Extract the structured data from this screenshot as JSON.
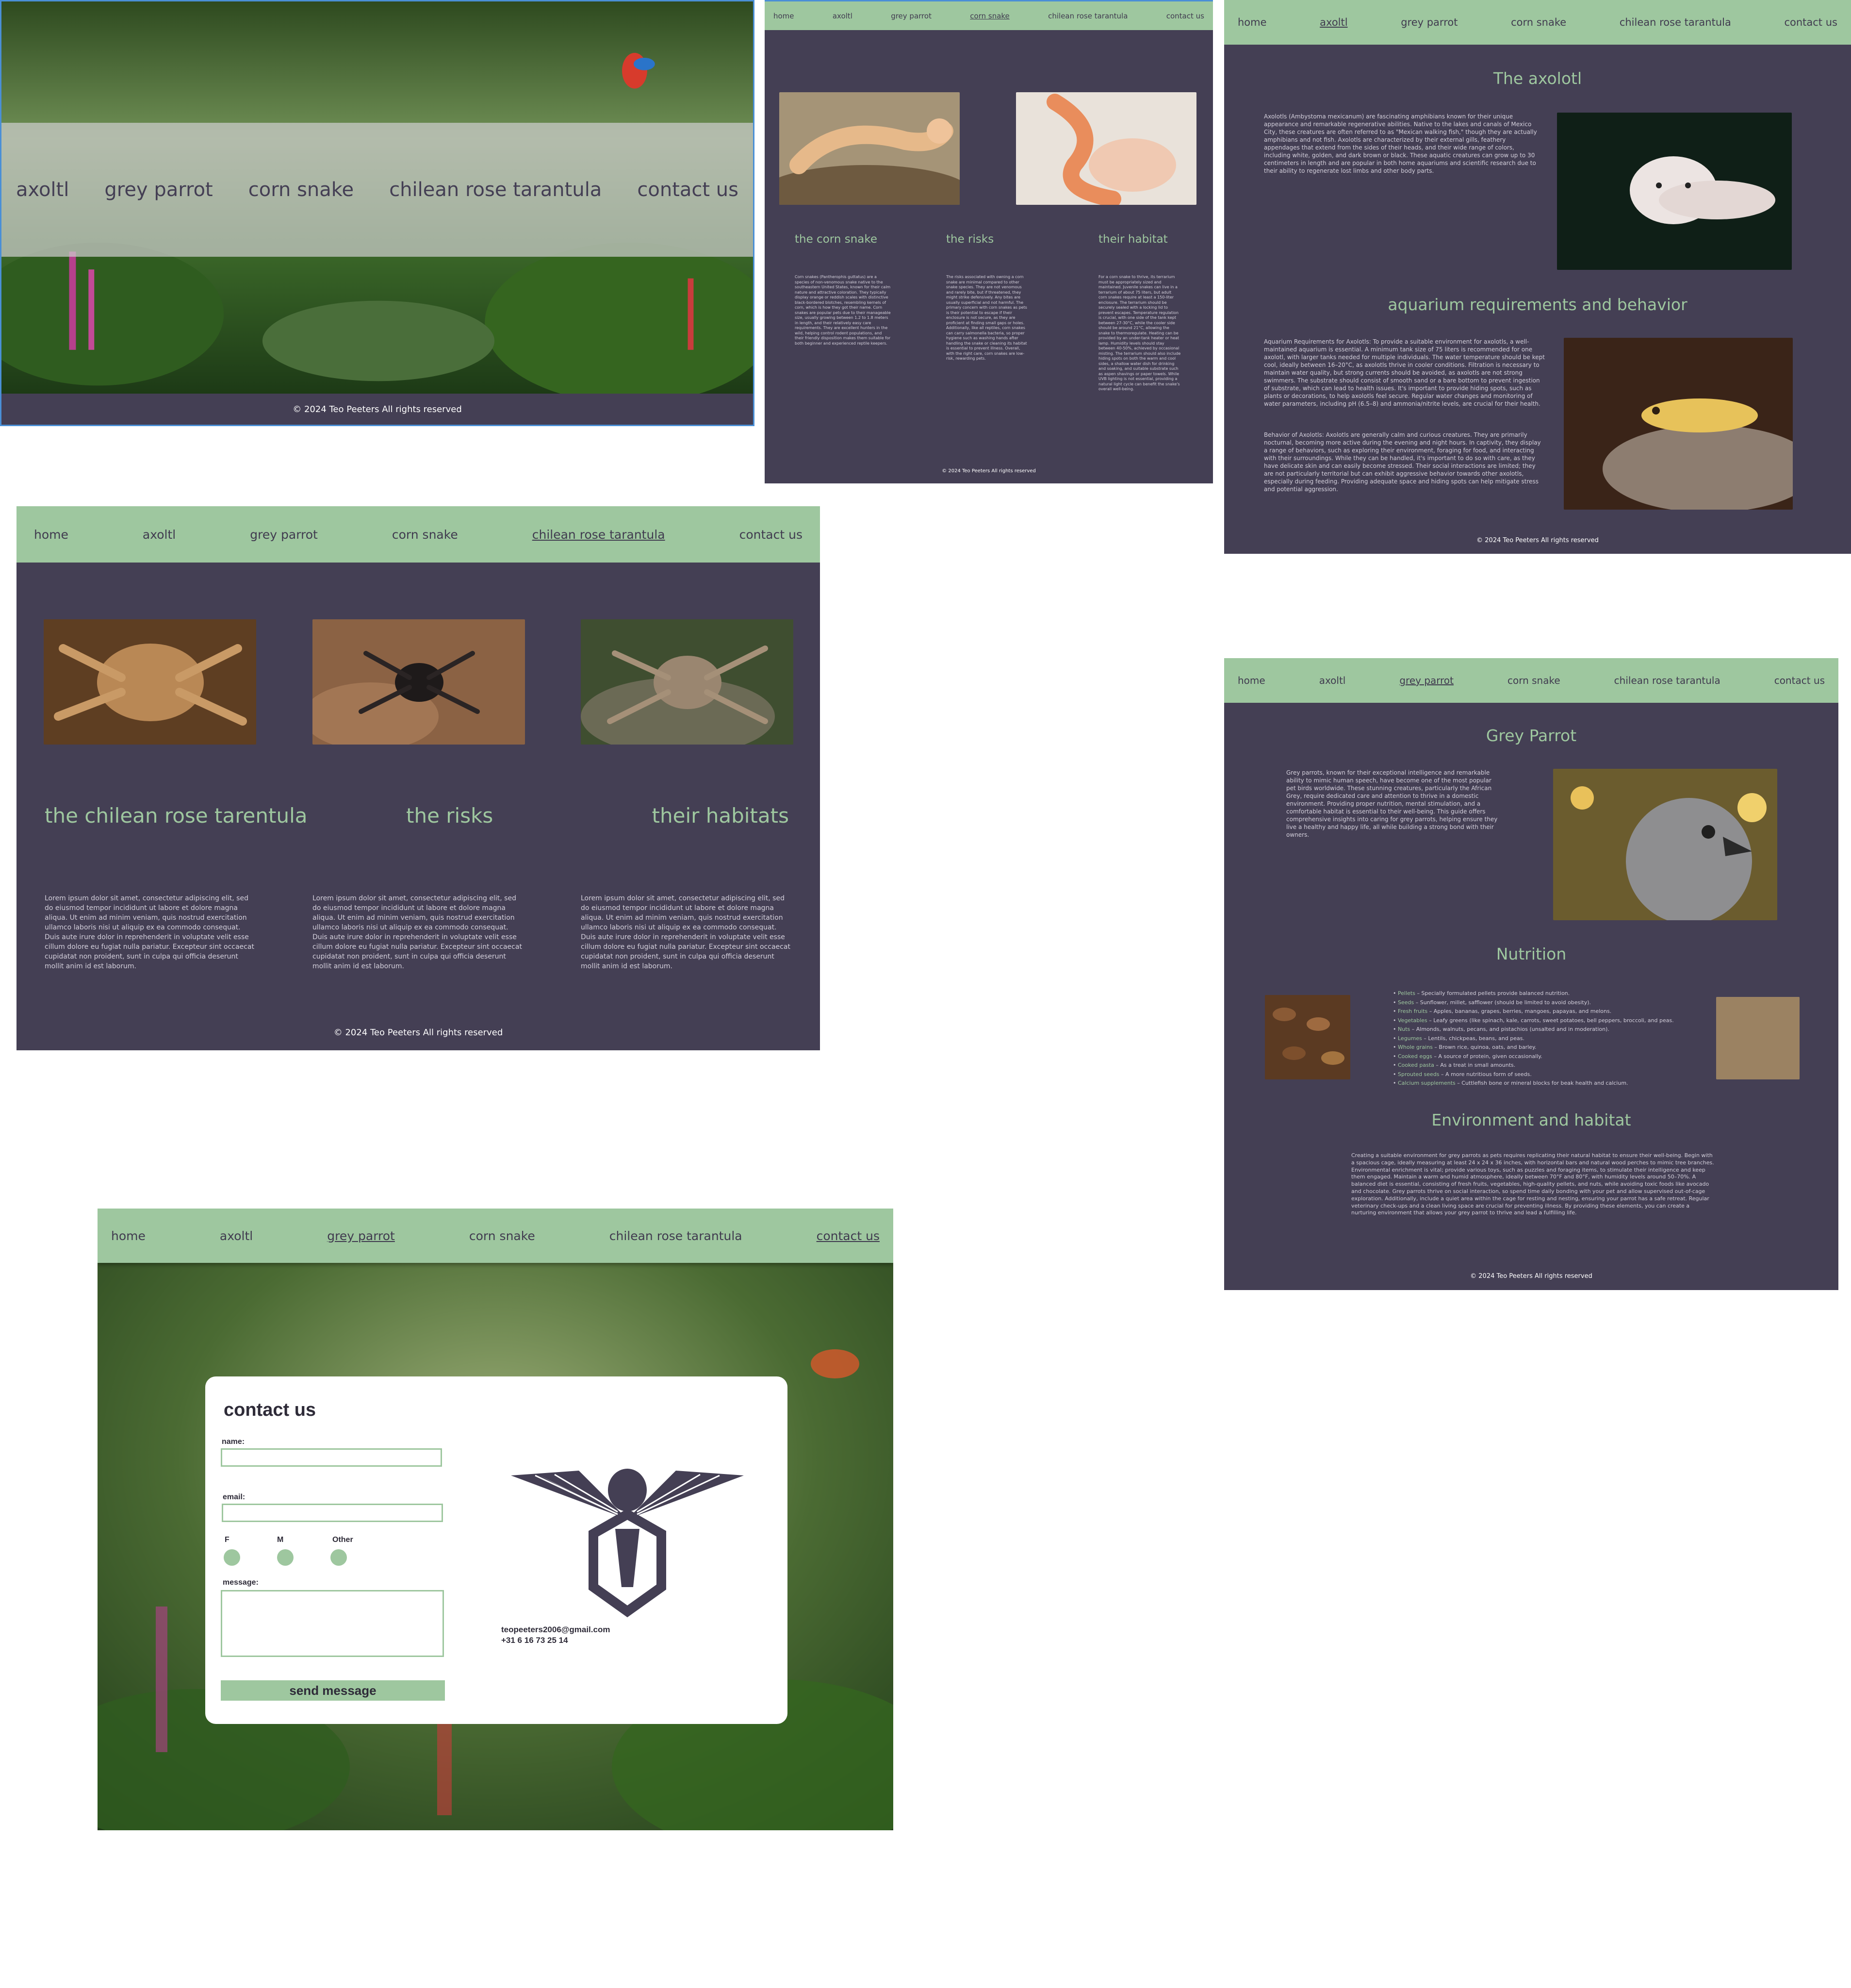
{
  "nav": {
    "home": "home",
    "axolotl": "axoltl",
    "parrot": "grey parrot",
    "snake": "corn snake",
    "tarantula": "chilean rose tarantula",
    "contact": "contact us"
  },
  "footer": "© 2024 Teo Peeters All rights reserved",
  "home_page": {
    "menu": [
      "axoltl",
      "grey parrot",
      "corn snake",
      "chilean rose tarantula",
      "contact us"
    ]
  },
  "snake_page": {
    "columns": [
      {
        "heading": "the corn snake",
        "body": "Corn snakes (Pantherophis guttatus) are a species of non-venomous snake native to the southeastern United States, known for their calm nature and attractive coloration. They typically display orange or reddish scales with distinctive black-bordered blotches, resembling kernels of corn, which is how they got their name. Corn snakes are popular pets due to their manageable size, usually growing between 1.2 to 1.8 meters in length, and their relatively easy care requirements. They are excellent hunters in the wild, helping control rodent populations, and their friendly disposition makes them suitable for both beginner and experienced reptile keepers."
      },
      {
        "heading": "the risks",
        "body": "The risks associated with owning a corn snake are minimal compared to other snake species. They are not venomous and rarely bite, but if threatened, they might strike defensively. Any bites are usually superficial and not harmful. The primary concern with corn snakes as pets is their potential to escape if their enclosure is not secure, as they are proficient at finding small gaps or holes. Additionally, like all reptiles, corn snakes can carry salmonella bacteria, so proper hygiene such as washing hands after handling the snake or cleaning its habitat is essential to prevent illness. Overall, with the right care, corn snakes are low-risk, rewarding pets."
      },
      {
        "heading": "their habitat",
        "body": "For a corn snake to thrive, its terrarium must be appropriately sized and maintained. Juvenile snakes can live in a terrarium of about 75 liters, but adult corn snakes require at least a 150-liter enclosure. The terrarium should be securely sealed with a locking lid to prevent escapes. Temperature regulation is crucial, with one side of the tank kept between 27-30°C, while the cooler side should be around 21°C, allowing the snake to thermoregulate. Heating can be provided by an under-tank heater or heat lamp. Humidity levels should stay between 40-50%, achieved by occasional misting. The terrarium should also include hiding spots on both the warm and cool sides, a shallow water dish for drinking and soaking, and suitable substrate such as aspen shavings or paper towels. While UVB lighting is not essential, providing a natural light cycle can benefit the snake's overall well-being."
      }
    ]
  },
  "axolotl_page": {
    "title": "The axolotl",
    "intro": "Axolotls (Ambystoma mexicanum) are fascinating amphibians known for their unique appearance and remarkable regenerative abilities. Native to the lakes and canals of Mexico City, these creatures are often referred to as \"Mexican walking fish,\" though they are actually amphibians and not fish. Axolotls are characterized by their external gills, feathery appendages that extend from the sides of their heads, and their wide range of colors, including white, golden, and dark brown or black. These aquatic creatures can grow up to 30 centimeters in length and are popular in both home aquariums and scientific research due to their ability to regenerate lost limbs and other body parts.",
    "subtitle": "aquarium requirements and behavior",
    "req": "Aquarium Requirements for Axolotls: To provide a suitable environment for axolotls, a well-maintained aquarium is essential. A minimum tank size of 75 liters is recommended for one axolotl, with larger tanks needed for multiple individuals. The water temperature should be kept cool, ideally between 16–20°C, as axolotls thrive in cooler conditions. Filtration is necessary to maintain water quality, but strong currents should be avoided, as axolotls are not strong swimmers. The substrate should consist of smooth sand or a bare bottom to prevent ingestion of substrate, which can lead to health issues. It's important to provide hiding spots, such as plants or decorations, to help axolotls feel secure. Regular water changes and monitoring of water parameters, including pH (6.5–8) and ammonia/nitrite levels, are crucial for their health.",
    "behavior": "Behavior of Axolotls: Axolotls are generally calm and curious creatures. They are primarily nocturnal, becoming more active during the evening and night hours. In captivity, they display a range of behaviors, such as exploring their environment, foraging for food, and interacting with their surroundings. While they can be handled, it's important to do so with care, as they have delicate skin and can easily become stressed. Their social interactions are limited; they are not particularly territorial but can exhibit aggressive behavior towards other axolotls, especially during feeding. Providing adequate space and hiding spots can help mitigate stress and potential aggression."
  },
  "tarantula_page": {
    "columns": [
      {
        "heading": "the chilean rose tarentula"
      },
      {
        "heading": "the risks"
      },
      {
        "heading": "their habitats"
      }
    ],
    "lorem": "Lorem ipsum dolor sit amet, consectetur adipiscing elit, sed do eiusmod tempor incididunt ut labore et dolore magna aliqua. Ut enim ad minim veniam, quis nostrud exercitation ullamco laboris nisi ut aliquip ex ea commodo consequat. Duis aute irure dolor in reprehenderit in voluptate velit esse cillum dolore eu fugiat nulla pariatur. Excepteur sint occaecat cupidatat non proident, sunt in culpa qui officia deserunt mollit anim id est laborum."
  },
  "parrot_page": {
    "title": "Grey Parrot",
    "intro": "Grey parrots, known for their exceptional intelligence and remarkable ability to mimic human speech, have become one of the most popular pet birds worldwide. These stunning creatures, particularly the African Grey, require dedicated care and attention to thrive in a domestic environment. Providing proper nutrition, mental stimulation, and a comfortable habitat is essential to their well-being. This guide offers comprehensive insights into caring for grey parrots, helping ensure they live a healthy and happy life, all while building a strong bond with their owners.",
    "nutrition_title": "Nutrition",
    "nutrition": [
      {
        "name": "Pellets",
        "text": "– Specially formulated pellets provide balanced nutrition."
      },
      {
        "name": "Seeds",
        "text": "– Sunflower, millet, safflower (should be limited to avoid obesity)."
      },
      {
        "name": "Fresh fruits",
        "text": "– Apples, bananas, grapes, berries, mangoes, papayas, and melons."
      },
      {
        "name": "Vegetables",
        "text": "– Leafy greens (like spinach, kale, carrots, sweet potatoes, bell peppers, broccoli, and peas."
      },
      {
        "name": "Nuts",
        "text": "– Almonds, walnuts, pecans, and pistachios (unsalted and in moderation)."
      },
      {
        "name": "Legumes",
        "text": "– Lentils, chickpeas, beans, and peas."
      },
      {
        "name": "Whole grains",
        "text": "– Brown rice, quinoa, oats, and barley."
      },
      {
        "name": "Cooked eggs",
        "text": "– A source of protein, given occasionally."
      },
      {
        "name": "Cooked pasta",
        "text": "– As a treat in small amounts."
      },
      {
        "name": "Sprouted seeds",
        "text": "– A more nutritious form of seeds."
      },
      {
        "name": "Calcium supplements",
        "text": "– Cuttlefish bone or mineral blocks for beak health and calcium."
      }
    ],
    "env_title": "Environment and habitat",
    "env": "Creating a suitable environment for grey parrots as pets requires replicating their natural habitat to ensure their well-being. Begin with a spacious cage, ideally measuring at least 24 x 24 x 36 inches, with horizontal bars and natural wood perches to mimic tree branches. Environmental enrichment is vital; provide various toys, such as puzzles and foraging items, to stimulate their intelligence and keep them engaged. Maintain a warm and humid atmosphere, ideally between 70°F and 80°F, with humidity levels around 50–70%. A balanced diet is essential, consisting of fresh fruits, vegetables, high-quality pellets, and nuts, while avoiding toxic foods like avocado and chocolate. Grey parrots thrive on social interaction, so spend time daily bonding with your pet and allow supervised out-of-cage exploration. Additionally, include a quiet area within the cage for resting and nesting, ensuring your parrot has a safe retreat. Regular veterinary check-ups and a clean living space are crucial for preventing illness. By providing these elements, you can create a nurturing environment that allows your grey parrot to thrive and lead a fulfilling life."
  },
  "contact_page": {
    "title": "contact us",
    "name_label": "name:",
    "email_label": "email:",
    "gender": [
      "F",
      "M",
      "Other"
    ],
    "message_label": "message:",
    "send": "send message",
    "email": "teopeeters2006@gmail.com",
    "phone": "+31 6 16 73 25 14"
  },
  "colors": {
    "accent": "#9ec79f",
    "dark": "#443f54",
    "nav_text": "#403b4f"
  }
}
